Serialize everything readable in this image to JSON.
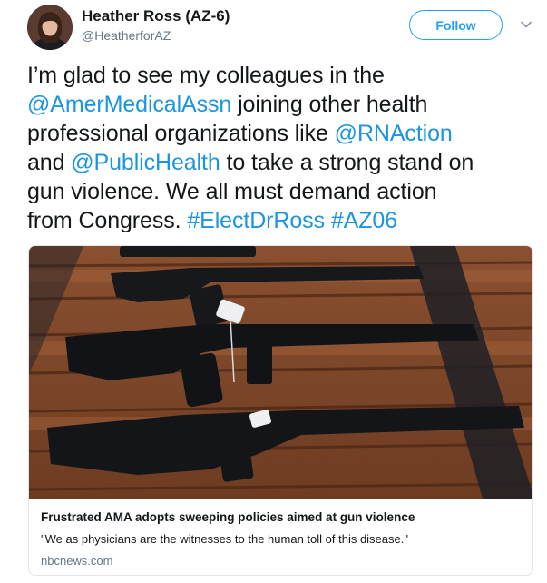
{
  "author": {
    "display_name": "Heather Ross (AZ-6)",
    "handle": "@HeatherforAZ",
    "avatar_icon": "profile-photo"
  },
  "actions": {
    "follow_label": "Follow",
    "more_icon": "chevron-down-icon"
  },
  "tweet": {
    "lines": [
      [
        {
          "text": "I’m glad to see my colleagues in the",
          "link": false
        }
      ],
      [
        {
          "text": "@AmerMedicalAssn",
          "link": true
        },
        {
          "text": " joining other health",
          "link": false
        }
      ],
      [
        {
          "text": "professional organizations like ",
          "link": false
        },
        {
          "text": "@RNAction",
          "link": true
        }
      ],
      [
        {
          "text": "and ",
          "link": false
        },
        {
          "text": "@PublicHealth",
          "link": true
        },
        {
          "text": " to take a strong stand on",
          "link": false
        }
      ],
      [
        {
          "text": "gun violence. We all must demand action",
          "link": false
        }
      ],
      [
        {
          "text": "from Congress. ",
          "link": false
        },
        {
          "text": "#ElectDrRoss",
          "link": true
        },
        {
          "text": " ",
          "link": false
        },
        {
          "text": "#AZ06",
          "link": true
        }
      ]
    ]
  },
  "card": {
    "image_description_icon": "rifles-on-wooden-table-photo",
    "title": "Frustrated AMA adopts sweeping policies aimed at gun violence",
    "description": "\"We as physicians are the witnesses to the human toll of this disease.\"",
    "domain": "nbcnews.com"
  },
  "colors": {
    "link": "#1b95e0",
    "follow": "#1da1f2",
    "secondary_text": "#657786",
    "border": "#e1e8ed"
  }
}
